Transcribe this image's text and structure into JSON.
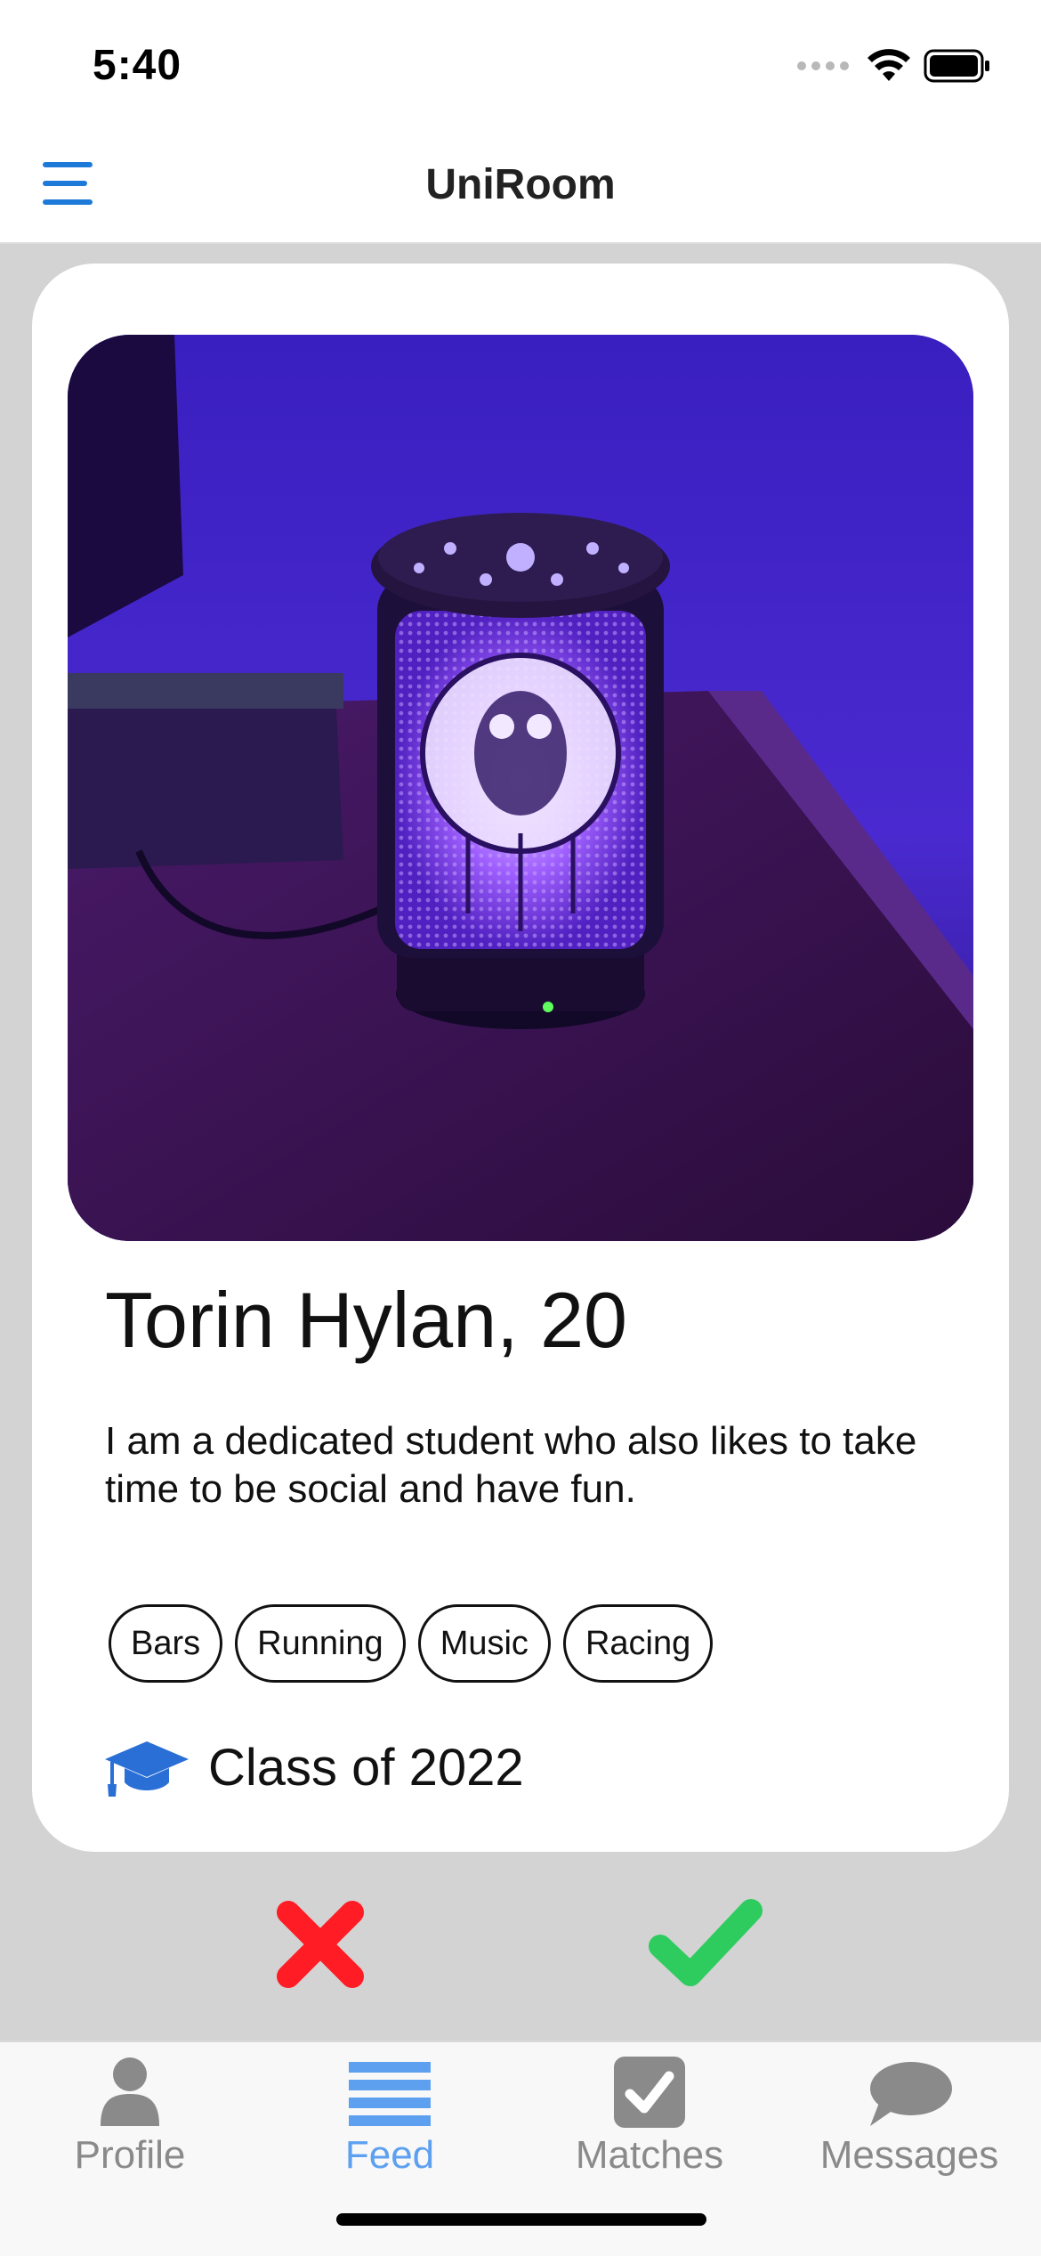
{
  "status_bar": {
    "time": "5:40",
    "icons": [
      "cellular-signal-icon",
      "wifi-icon",
      "battery-icon"
    ]
  },
  "header": {
    "title": "UniRoom",
    "menu_icon": "hamburger-menu-icon"
  },
  "profile": {
    "name": "Torin Hylan, 20",
    "bio": "I am a dedicated student who also likes to take time to be social and have fun.",
    "tags": [
      "Bars",
      "Running",
      "Music",
      "Racing"
    ],
    "class_year": "Class of 2022",
    "class_icon": "graduation-cap-icon",
    "photo": "photo of an owl-pattern lamp diffuser glowing purple"
  },
  "actions": {
    "reject_icon": "red-x-icon",
    "accept_icon": "green-check-icon"
  },
  "tab_bar": {
    "tabs": [
      {
        "label": "Profile",
        "icon": "person-icon",
        "active": false
      },
      {
        "label": "Feed",
        "icon": "list-icon",
        "active": true
      },
      {
        "label": "Matches",
        "icon": "checkbox-icon",
        "active": false
      },
      {
        "label": "Messages",
        "icon": "chat-bubble-icon",
        "active": false
      }
    ]
  },
  "colors": {
    "accent": "#1e7ad8",
    "active_tab": "#5da0f0",
    "inactive_tab": "#8a8a8a",
    "reject": "#ff1c24",
    "accept": "#2ecc5f",
    "background": "#d3d3d3",
    "graduation_cap": "#2a6fd6"
  }
}
